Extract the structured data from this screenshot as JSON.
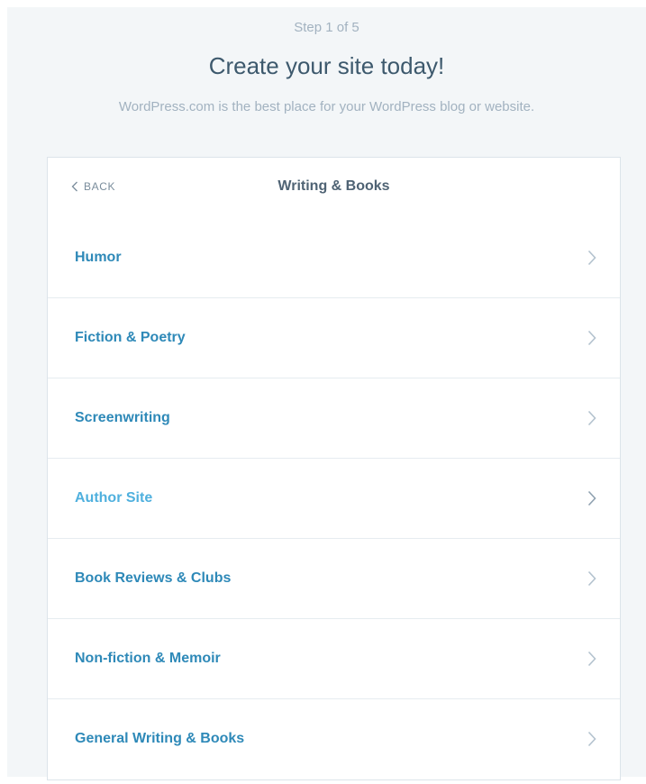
{
  "header": {
    "step": "Step 1 of 5",
    "title": "Create your site today!",
    "subtitle": "WordPress.com is the best place for your WordPress blog or website."
  },
  "card": {
    "back_label": "BACK",
    "title": "Writing & Books",
    "items": [
      {
        "label": "Humor"
      },
      {
        "label": "Fiction & Poetry"
      },
      {
        "label": "Screenwriting"
      },
      {
        "label": "Author Site"
      },
      {
        "label": "Book Reviews & Clubs"
      },
      {
        "label": "Non-fiction & Memoir"
      },
      {
        "label": "General Writing & Books"
      }
    ]
  },
  "icons": {
    "back": "chevron-left-icon",
    "row": "chevron-right-icon"
  },
  "colors": {
    "page_bg": "#f3f6f8",
    "item_text": "#2e89b8",
    "item_text_hover": "#4fb0de",
    "heading_text": "#3d596d",
    "muted_text": "#a2b2c0",
    "chevron": "#b3c2ce"
  }
}
